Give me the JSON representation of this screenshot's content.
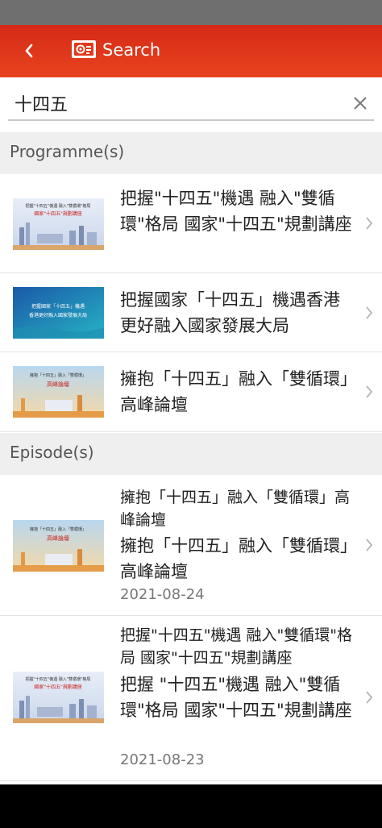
{
  "header": {
    "title": "Search",
    "back_icon": "chevron-left-icon",
    "logo_icon": "tv-logo-icon",
    "color": "#e03a1c"
  },
  "search": {
    "value": "十四五",
    "placeholder": "",
    "clear_icon": "close-icon"
  },
  "sections": {
    "programmes": {
      "label": "Programme(s)"
    },
    "episodes": {
      "label": "Episode(s)"
    }
  },
  "programmes": [
    {
      "title": "把握\"十四五\"機遇 融入\"雙循環\"格局 國家\"十四五\"規劃講座",
      "thumb_text_top": "把握\"十四五\"機遇 融入\"雙循環\"格局",
      "thumb_text_main": "國家\"十四五\"規劃講座"
    },
    {
      "title": "把握國家「十四五」機遇香港更好融入國家發展大局",
      "thumb_text_top": "把握國家「十四五」機遇",
      "thumb_text_main": "香港更好融入國家發展大局"
    },
    {
      "title": "擁抱「十四五」融入「雙循環」高峰論壇",
      "thumb_text_top": "擁抱「十四五」融入「雙循環」",
      "thumb_text_main": "高峰論壇"
    }
  ],
  "episodes": [
    {
      "program": "擁抱「十四五」融入「雙循環」高峰論壇",
      "title": "擁抱「十四五」融入「雙循環」高峰論壇",
      "date": "2021-08-24",
      "thumb_text_top": "擁抱「十四五」融入「雙循環」",
      "thumb_text_main": "高峰論壇"
    },
    {
      "program": "把握\"十四五\"機遇 融入\"雙循環\"格局 國家\"十四五\"規劃講座",
      "title": "把握 \"十四五\"機遇 融入\"雙循環\"格局 國家\"十四五\"規劃講座",
      "date": "2021-08-23",
      "thumb_text_top": "把握\"十四五\"機遇 融入\"雙循環\"格局",
      "thumb_text_main": "國家\"十四五\"規劃講座"
    }
  ]
}
